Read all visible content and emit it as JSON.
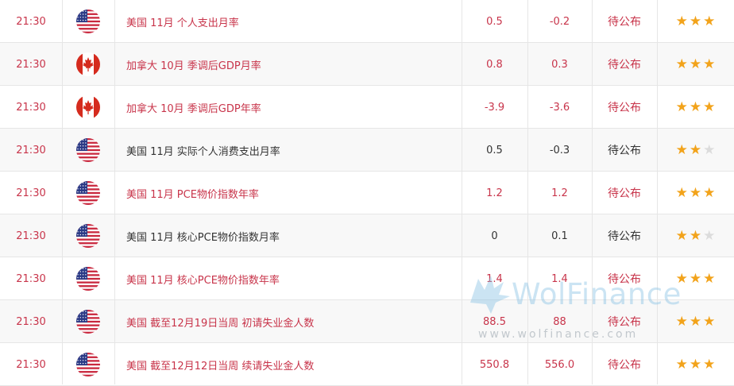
{
  "colors": {
    "important": "#c8344a",
    "normal": "#333333",
    "star_on": "#f2a31b",
    "star_off": "#dcdcdc",
    "row_alt": "#f8f8f8"
  },
  "watermark": {
    "brand": "WolFinance",
    "url": "www.wolfinance.com"
  },
  "rows": [
    {
      "time": "21:30",
      "flag": "us-flag-icon",
      "event": "美国 11月 个人支出月率",
      "previous": "0.5",
      "forecast": "-0.2",
      "actual": "待公布",
      "importance": 3,
      "highlight": true
    },
    {
      "time": "21:30",
      "flag": "canada-flag-icon",
      "event": "加拿大 10月 季调后GDP月率",
      "previous": "0.8",
      "forecast": "0.3",
      "actual": "待公布",
      "importance": 3,
      "highlight": true
    },
    {
      "time": "21:30",
      "flag": "canada-flag-icon",
      "event": "加拿大 10月 季调后GDP年率",
      "previous": "-3.9",
      "forecast": "-3.6",
      "actual": "待公布",
      "importance": 3,
      "highlight": true
    },
    {
      "time": "21:30",
      "flag": "us-flag-icon",
      "event": "美国 11月 实际个人消费支出月率",
      "previous": "0.5",
      "forecast": "-0.3",
      "actual": "待公布",
      "importance": 2,
      "highlight": false
    },
    {
      "time": "21:30",
      "flag": "us-flag-icon",
      "event": "美国 11月 PCE物价指数年率",
      "previous": "1.2",
      "forecast": "1.2",
      "actual": "待公布",
      "importance": 3,
      "highlight": true
    },
    {
      "time": "21:30",
      "flag": "us-flag-icon",
      "event": "美国 11月 核心PCE物价指数月率",
      "previous": "0",
      "forecast": "0.1",
      "actual": "待公布",
      "importance": 2,
      "highlight": false
    },
    {
      "time": "21:30",
      "flag": "us-flag-icon",
      "event": "美国 11月 核心PCE物价指数年率",
      "previous": "1.4",
      "forecast": "1.4",
      "actual": "待公布",
      "importance": 3,
      "highlight": true
    },
    {
      "time": "21:30",
      "flag": "us-flag-icon",
      "event": "美国 截至12月19日当周 初请失业金人数",
      "previous": "88.5",
      "forecast": "88",
      "actual": "待公布",
      "importance": 3,
      "highlight": true
    },
    {
      "time": "21:30",
      "flag": "us-flag-icon",
      "event": "美国 截至12月12日当周 续请失业金人数",
      "previous": "550.8",
      "forecast": "556.0",
      "actual": "待公布",
      "importance": 3,
      "highlight": true
    }
  ]
}
